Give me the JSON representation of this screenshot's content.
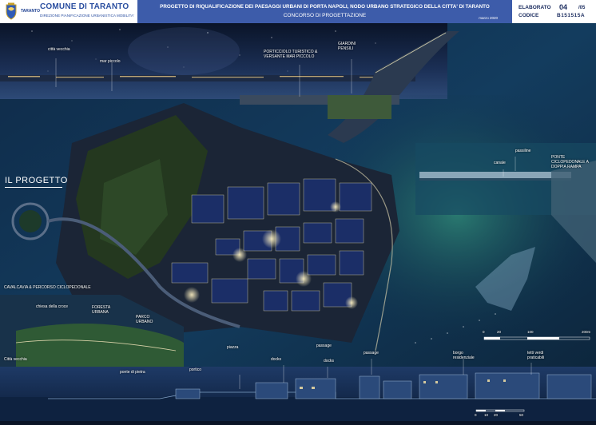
{
  "header": {
    "brand": "COMUNE DI TARANTO",
    "taranto_small": "TARANTO",
    "department": "DIREZIONE PIANIFICAZIONE URBANISTICA MOBILITA'",
    "title": "PROGETTO DI RIQUALIFICAZIONE DEI PAESAGGI URBANI DI PORTA NAPOLI, NODO URBANO STRATEGICO DELLA CITTA' DI TARANTO",
    "subtitle": "CONCORSO DI PROGETTAZIONE",
    "date": "marzo 2020",
    "elaborato_label": "ELABORATO",
    "elaborato_value": "04",
    "elaborato_total": "/05",
    "codice_label": "CODICE",
    "codice_value": "B151515A"
  },
  "section_title": "IL PROGETTO",
  "labels": {
    "citta_vecchia_top": "città vecchia",
    "mar_piccolo": "mar piccolo",
    "porticciolo": "PORTICCIOLO TURISTICO & VERSANTE MAR PICCOLO",
    "giardini": "GIARDINI PENSILI",
    "passiline": "passiline",
    "canale": "canale",
    "ponte": "PONTE CICLOPEDONALE A DOPPIA RAMPA",
    "cavalcavia": "CAVALCAVIA & PERCORSO CICLOPEDONALE",
    "chiesa": "chiesa della croce",
    "foresta": "FORESTA URBANA",
    "parco": "PARCO URBANO",
    "citta_vecchia_bottom": "Città vecchia",
    "ponte_pietra": "ponte di pietra",
    "portico": "portico",
    "piazza": "piazza",
    "docks_1": "docks",
    "passage": "passage",
    "docks_2": "docks",
    "passage_2": "passage",
    "borgo": "borgo residenziale",
    "tetti": "tetti verdi praticabili"
  },
  "scale_top": [
    "0",
    "20",
    "100",
    "200m"
  ],
  "scale_bottom": [
    "0",
    "10",
    "20",
    "50"
  ],
  "colors": {
    "title_bar": "#3d5caa",
    "brand_blue": "#2b4fa0",
    "sky": "#0f1d3a",
    "sea": "#123a57",
    "teal_sea": "#1b5a5e",
    "greenery": "#2c4a2a",
    "light": "#ffe9a8"
  }
}
